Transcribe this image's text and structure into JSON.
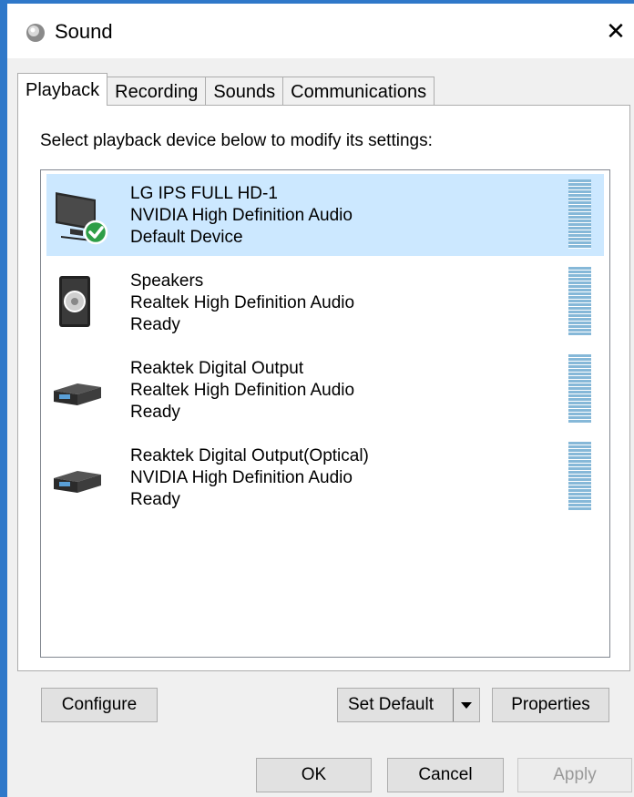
{
  "window": {
    "title": "Sound",
    "close_glyph": "✕"
  },
  "tabs": [
    {
      "label": "Playback",
      "active": true
    },
    {
      "label": "Recording",
      "active": false
    },
    {
      "label": "Sounds",
      "active": false
    },
    {
      "label": "Communications",
      "active": false
    }
  ],
  "instruction": "Select playback device below to modify its settings:",
  "devices": [
    {
      "name": "LG IPS FULL HD-1",
      "driver": "NVIDIA High Definition Audio",
      "status": "Default Device",
      "icon": "monitor-icon",
      "selected": true
    },
    {
      "name": "Speakers",
      "driver": "Realtek High Definition Audio",
      "status": "Ready",
      "icon": "speaker-icon",
      "selected": false
    },
    {
      "name": "Reaktek Digital Output",
      "driver": "Realtek High Definition Audio",
      "status": "Ready",
      "icon": "digital-output-icon",
      "selected": false
    },
    {
      "name": "Reaktek Digital Output(Optical)",
      "driver": "NVIDIA High Definition Audio",
      "status": "Ready",
      "icon": "digital-output-icon",
      "selected": false
    }
  ],
  "buttons": {
    "configure": "Configure",
    "set_default": "Set Default",
    "properties": "Properties",
    "ok": "OK",
    "cancel": "Cancel",
    "apply": "Apply"
  },
  "colors": {
    "selection": "#cce8ff",
    "window_border": "#2f78c9",
    "default_check": "#2e9e47"
  }
}
